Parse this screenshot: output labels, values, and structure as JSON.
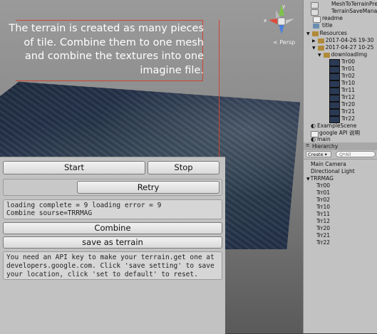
{
  "annotation": {
    "lines": [
      "The terrain is created as many pieces",
      "of tile. Combine them to one mesh",
      "and combine the textures into one",
      "imagine file."
    ]
  },
  "gizmo": {
    "persp_label": "< Persp",
    "y": "y",
    "x": "x"
  },
  "panel": {
    "start": "Start",
    "stop": "Stop",
    "retry": "Retry",
    "status_line1": "loading complete = 9  loading error = 9",
    "status_line2": "Combine sourse=TRRMAG",
    "combine": "Combine",
    "save_terrain": "save as terrain",
    "info": "You need an API key to make your terrain.get one at developers.google.com. Click 'save setting' to save your location, click 'set to default' to reset."
  },
  "project": {
    "items": [
      "MeshToTerrainPre",
      "TerrainSaveManag",
      "readme",
      "title",
      "Resources",
      "2017-04-26 19-30",
      "2017-04-27 10-25",
      "downloadImg"
    ],
    "textures": [
      "Trr00",
      "Trr01",
      "Trr02",
      "Trr10",
      "Trr11",
      "Trr12",
      "Trr20",
      "Trr21",
      "Trr22"
    ],
    "scenes": [
      "ExampleScene",
      "google API 说明",
      "main"
    ]
  },
  "hierarchy": {
    "tab": "Hierarchy",
    "create": "Create",
    "search_placeholder": "Q*All",
    "roots": [
      "Main Camera",
      "Directional Light",
      "TRRMAG"
    ],
    "children": [
      "Trr00",
      "Trr01",
      "Trr02",
      "Trr10",
      "Trr11",
      "Trr12",
      "Trr20",
      "Trr21",
      "Trr22"
    ]
  },
  "colors": {
    "annotation": "#cc4433",
    "panel": "#c2c2c2",
    "sky": "#8e8e8e",
    "terrain": "#24324a"
  }
}
